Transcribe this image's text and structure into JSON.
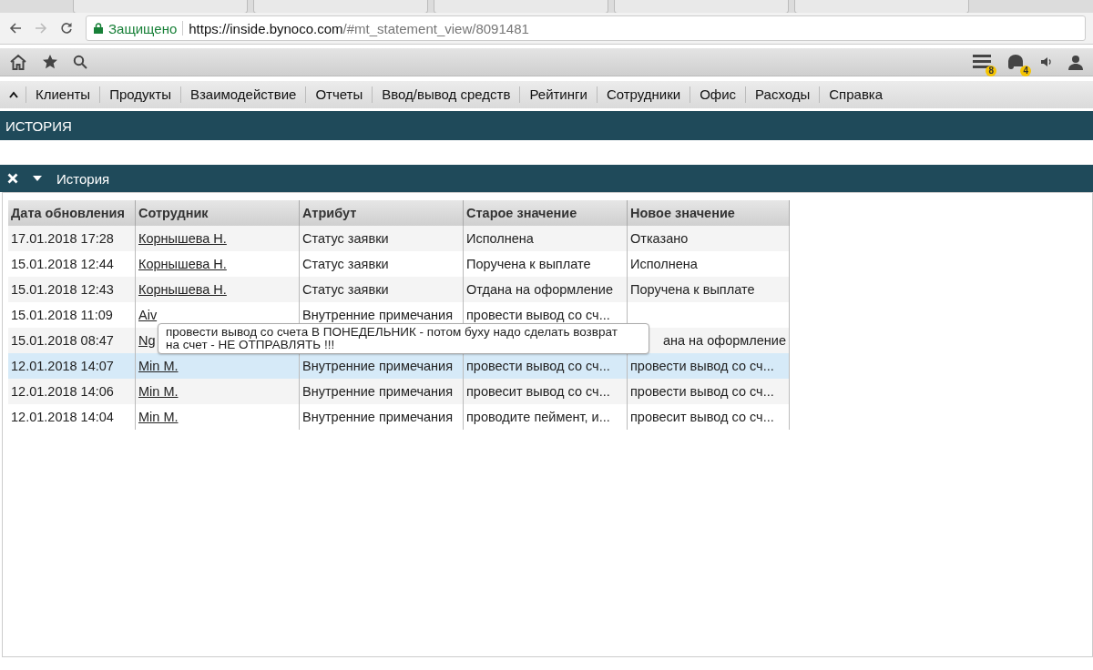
{
  "browser": {
    "secure_label": "Защищено",
    "url_host": "https://inside.bynoco.com",
    "url_path": "/#mt_statement_view/8091481"
  },
  "toolbar": {
    "badges": [
      {
        "kind": "list",
        "count": "8"
      },
      {
        "kind": "chat",
        "count": "4"
      }
    ]
  },
  "menu": {
    "items": [
      "Клиенты",
      "Продукты",
      "Взаимодействие",
      "Отчеты",
      "Ввод/вывод средств",
      "Рейтинги",
      "Сотрудники",
      "Офис",
      "Расходы",
      "Справка"
    ]
  },
  "section_title": "ИСТОРИЯ",
  "panel": {
    "title": "История"
  },
  "table": {
    "columns": [
      "Дата обновления",
      "Сотрудник",
      "Атрибут",
      "Старое значение",
      "Новое значение"
    ],
    "rows": [
      {
        "date": "17.01.2018 17:28",
        "employee": "Корнышева Н.",
        "attribute": "Статус заявки",
        "old": "Исполнена",
        "new": "Отказано",
        "selected": false,
        "covered": false
      },
      {
        "date": "15.01.2018 12:44",
        "employee": "Корнышева Н.",
        "attribute": "Статус заявки",
        "old": "Поручена к выплате",
        "new": "Исполнена",
        "selected": false,
        "covered": false
      },
      {
        "date": "15.01.2018 12:43",
        "employee": "Корнышева Н.",
        "attribute": "Статус заявки",
        "old": "Отдана на оформление",
        "new": "Поручена к выплате",
        "selected": false,
        "covered": false
      },
      {
        "date": "15.01.2018 11:09",
        "employee": "Aiv",
        "attribute": "Внутренние примечания",
        "old": "провести вывод со сч...",
        "new": "",
        "selected": false,
        "covered": false
      },
      {
        "date": "15.01.2018 08:47",
        "employee": "Ng",
        "attribute": "",
        "old": "",
        "new": "ана на оформление",
        "selected": false,
        "covered": true
      },
      {
        "date": "12.01.2018 14:07",
        "employee": "Min M.",
        "attribute": "Внутренние примечания",
        "old": "провести вывод со сч...",
        "new": "провести вывод со сч...",
        "selected": true,
        "covered": false
      },
      {
        "date": "12.01.2018 14:06",
        "employee": "Min M.",
        "attribute": "Внутренние примечания",
        "old": "провесит вывод со сч...",
        "new": "провести вывод со сч...",
        "selected": false,
        "covered": false
      },
      {
        "date": "12.01.2018 14:04",
        "employee": "Min M.",
        "attribute": "Внутренние примечания",
        "old": "проводите пеймент, и...",
        "new": "провесит вывод со сч...",
        "selected": false,
        "covered": false
      }
    ]
  },
  "tooltip": {
    "text": "провести вывод со счета В ПОНЕДЕЛЬНИК - потом буху надо сделать возврат на счет - НЕ ОТПРАВЛЯТЬ !!!"
  }
}
